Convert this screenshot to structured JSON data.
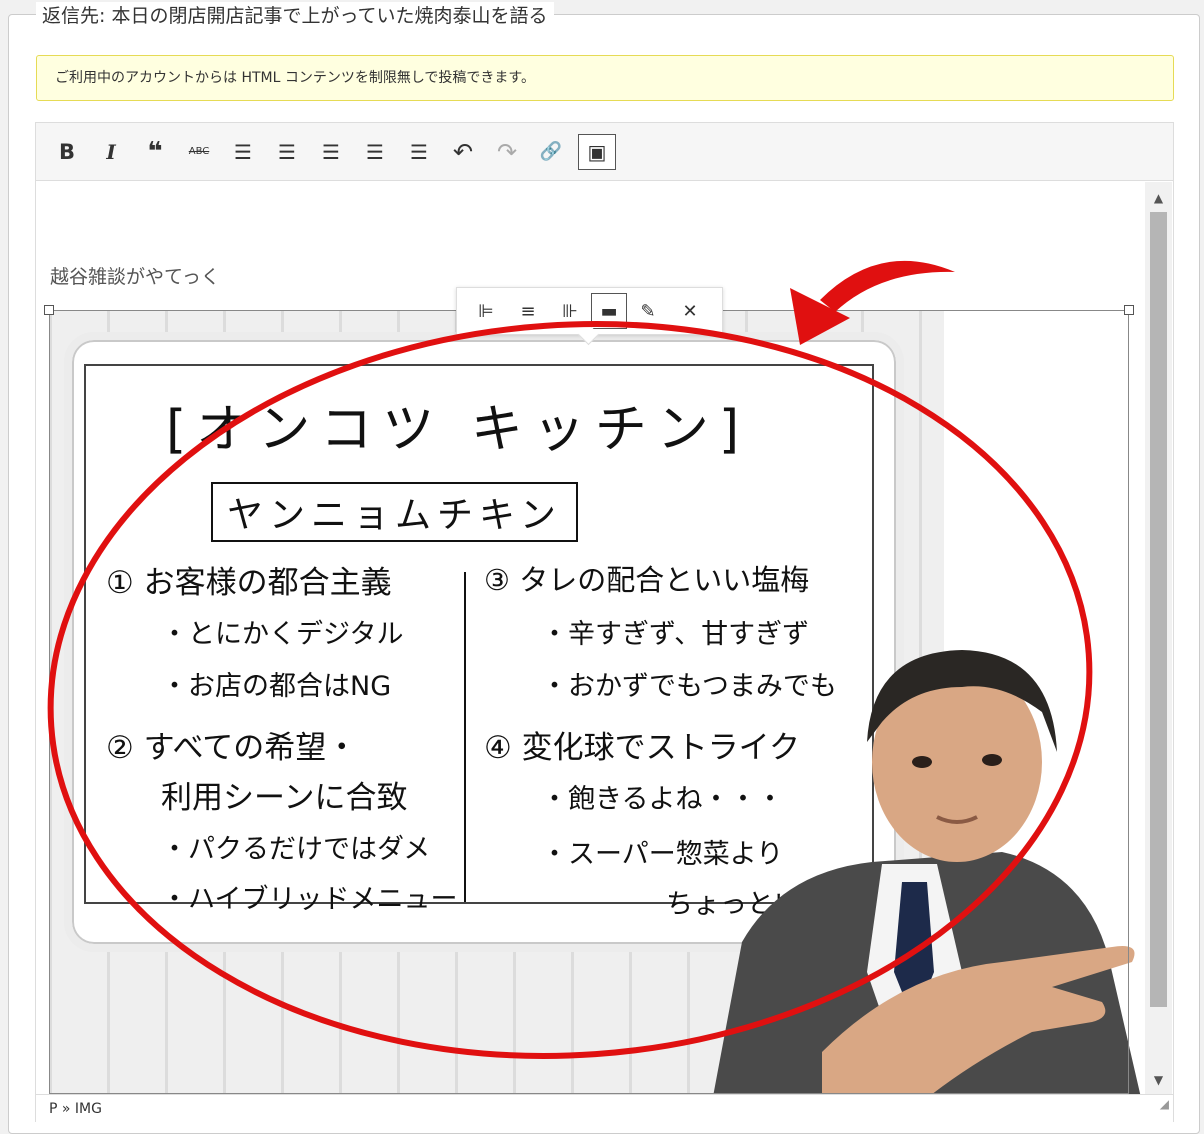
{
  "form": {
    "legend": "返信先: 本日の閉店開店記事で上がっていた焼肉泰山を語る"
  },
  "notice": {
    "text": "ご利用中のアカウントからは HTML コンテンツを制限無しで投稿できます。"
  },
  "toolbar": {
    "bold": "B",
    "italic": "I",
    "blockquote": "❝",
    "strike": "ABC",
    "ul": "☰",
    "ol": "☰",
    "align_left": "☰",
    "align_center": "☰",
    "align_right": "☰",
    "undo": "↶",
    "redo": "↷",
    "link": "🔗",
    "image": "▣"
  },
  "content": {
    "paragraph": "越谷雑談がやてっく"
  },
  "image": {
    "whiteboard": {
      "title": "[オンコツ キッチン]",
      "subtitle": "ヤンニョムチキン",
      "items": [
        "① お客様の都合主義",
        "・とにかくデジタル",
        "・お店の都合はNG",
        "② すべての希望・",
        "利用シーンに合致",
        "・パクるだけではダメ",
        "・ハイブリッドメニュー",
        "③ タレの配合といい塩梅",
        "・辛すぎず、甘すぎず",
        "・おかずでもつまみでも",
        "④ 変化球でストライク",
        "・飽きるよね・・・",
        "・スーパー惣菜より",
        "ちょっといい"
      ]
    },
    "float_toolbar": {
      "align_left": "⊫",
      "align_center": "≡",
      "align_right": "⊪",
      "align_none": "▬",
      "edit": "✎",
      "remove": "✕"
    }
  },
  "statusbar": {
    "path": "P » IMG"
  },
  "colors": {
    "annotation": "#e01010",
    "notice_bg": "#ffffe0",
    "notice_border": "#e6db55"
  }
}
